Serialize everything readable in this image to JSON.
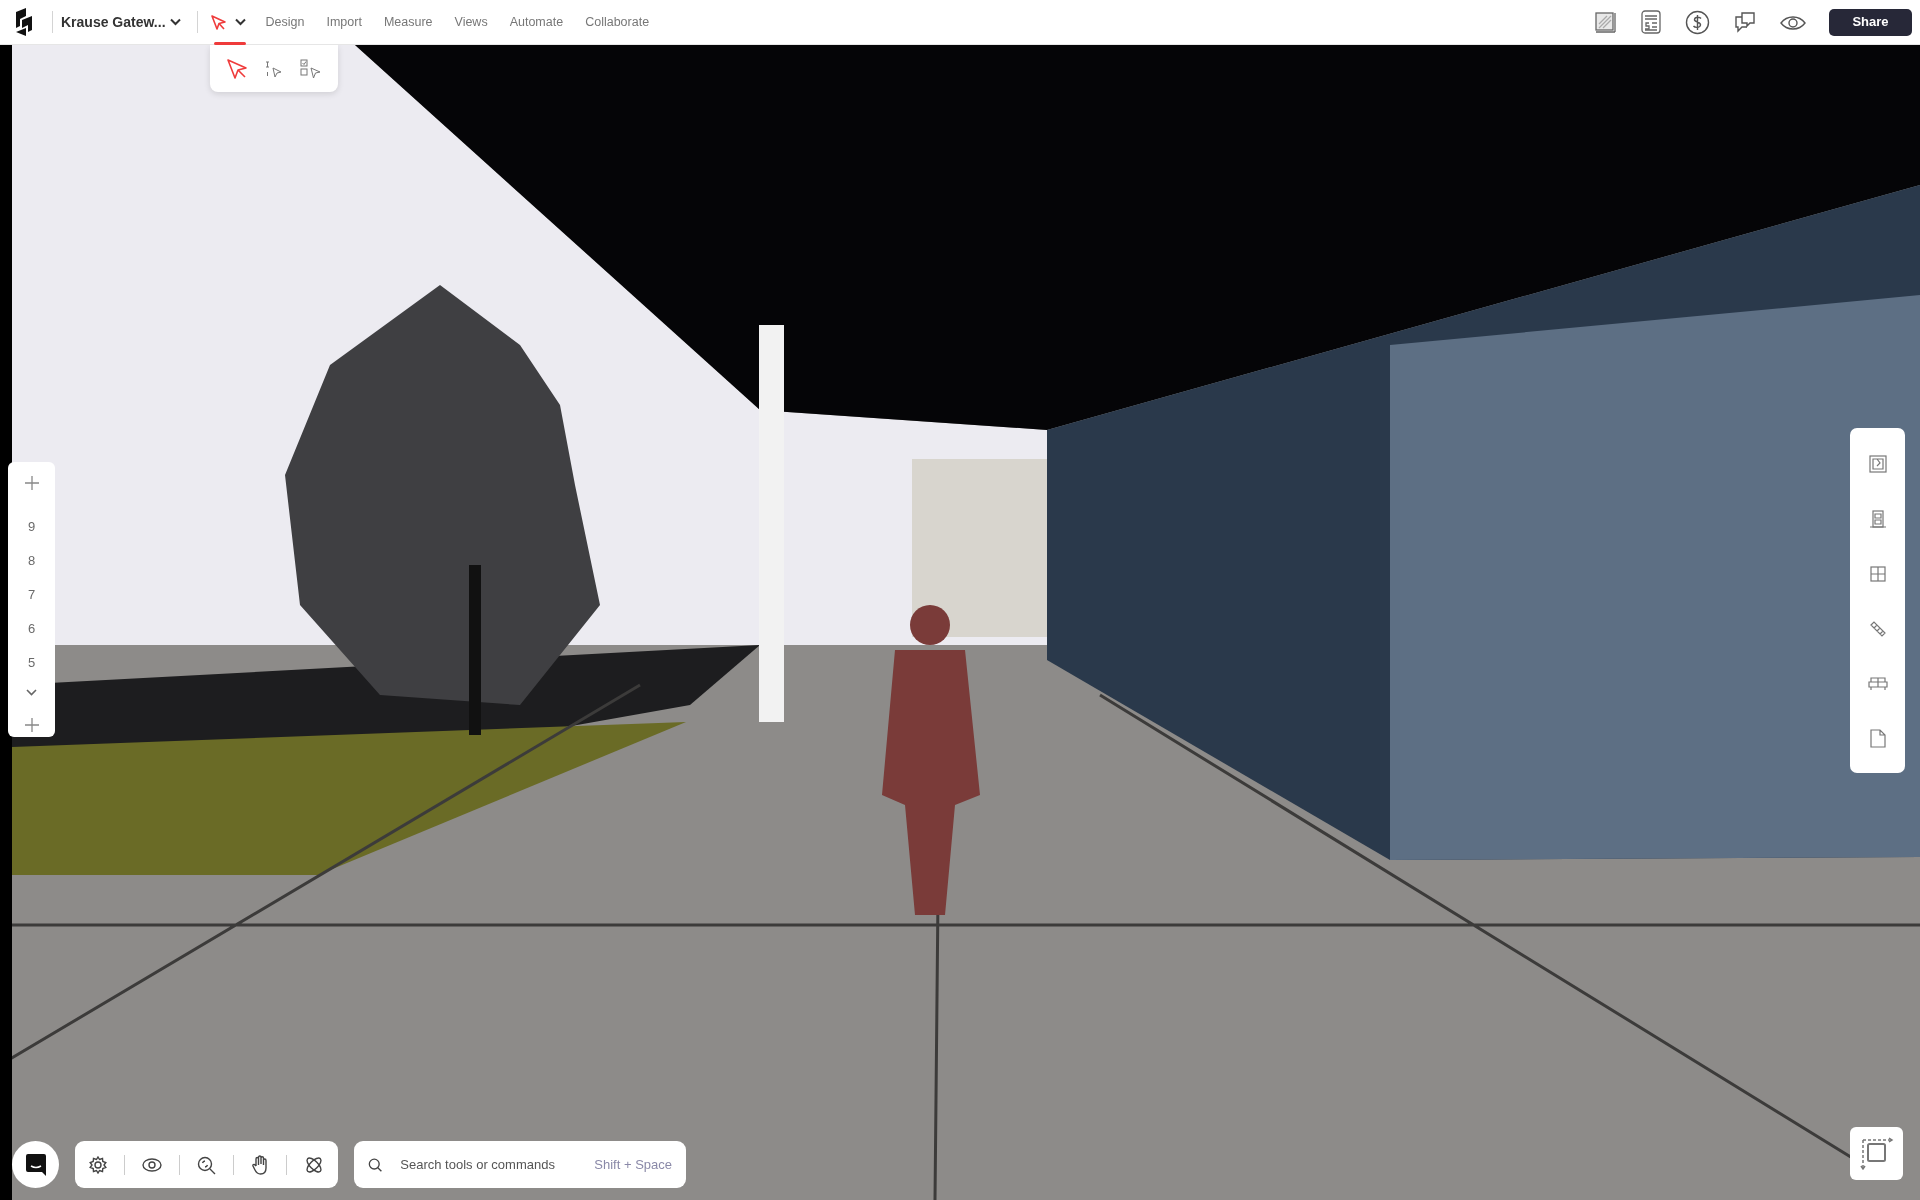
{
  "top_bar": {
    "project_name": "Krause Gatew...",
    "active_tool": {
      "selected": true
    },
    "menu": [
      {
        "label": "Design"
      },
      {
        "label": "Import"
      },
      {
        "label": "Measure"
      },
      {
        "label": "Views"
      },
      {
        "label": "Automate"
      },
      {
        "label": "Collaborate"
      }
    ],
    "share_button": "Share"
  },
  "tool_flyout": [
    {
      "kind": "select",
      "selected": true
    },
    {
      "kind": "sequence",
      "selected": false
    },
    {
      "kind": "multi",
      "selected": false
    }
  ],
  "storey_panel": {
    "levels": [
      "9",
      "8",
      "7",
      "6",
      "5"
    ]
  },
  "search": {
    "placeholder": "Search tools or commands",
    "shortcut": "Shift + Space"
  }
}
